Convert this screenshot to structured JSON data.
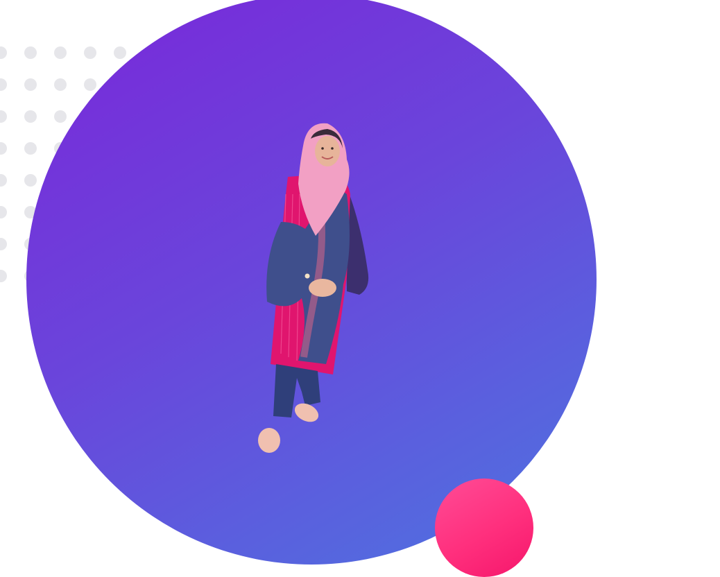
{
  "scene": {
    "subject": "person-portrait",
    "colors": {
      "background": "#ffffff",
      "main_circle_start": "#7a27d9",
      "main_circle_end": "#4d74e0",
      "accent_circle_start": "#ff4c96",
      "accent_circle_end": "#f5166b",
      "dot_grid": "#e6e6ea",
      "hijab": "#f2a0c4",
      "dress": "#e0156e",
      "shawl": "#3f4f8c",
      "trousers": "#2f3f7a",
      "sandals": "#f0c0b0"
    },
    "icons": [
      "dot-grid-decoration",
      "portrait-figure"
    ]
  }
}
